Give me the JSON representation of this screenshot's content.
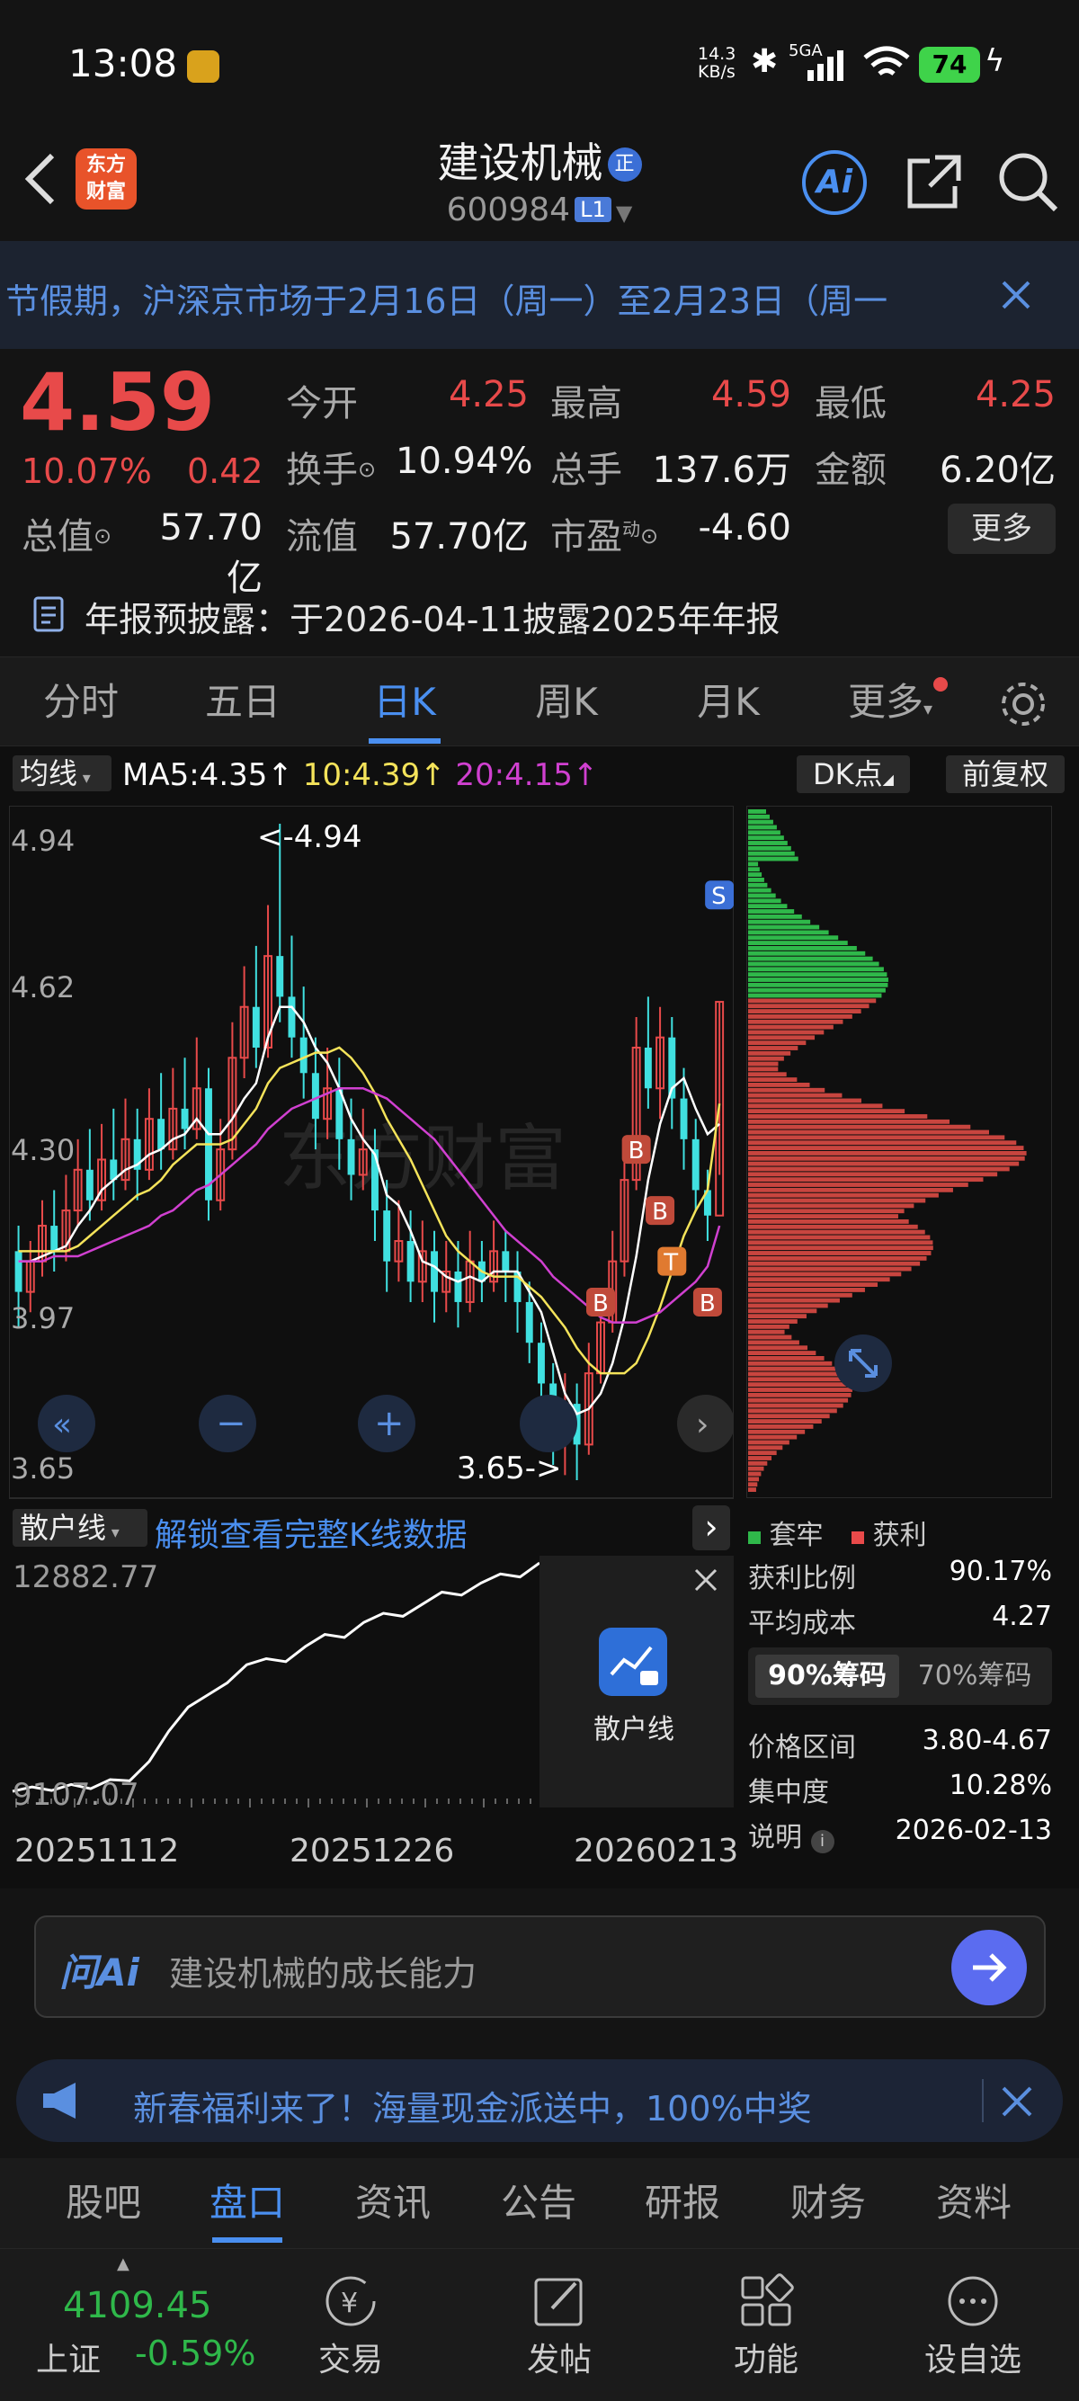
{
  "status": {
    "time": "13:08",
    "net_speed_value": "14.3",
    "net_speed_unit": "KB/s",
    "signal": "5GA",
    "battery": "74"
  },
  "nav": {
    "title": "建设机械",
    "title_badge": "正",
    "code": "600984",
    "level": "L1",
    "logo_line1": "东方",
    "logo_line2": "财富",
    "ai_label": "Ai"
  },
  "notice": {
    "text": "节假期，沪深京市场于2月16日（周一）至2月23日（周一"
  },
  "quote": {
    "price": "4.59",
    "change_pct": "10.07%",
    "change": "0.42",
    "open_label": "今开",
    "open": "4.25",
    "high_label": "最高",
    "high": "4.59",
    "low_label": "最低",
    "low": "4.25",
    "turnover_label": "换手",
    "turnover": "10.94%",
    "volume_label": "总手",
    "volume": "137.6万",
    "amount_label": "金额",
    "amount": "6.20亿",
    "mktcap_label": "总值",
    "mktcap": "57.70亿",
    "float_label": "流值",
    "float": "57.70亿",
    "pe_label": "市盈",
    "pe_sup": "动",
    "pe": "-4.60",
    "more_button": "更多",
    "report_text": "年报预披露：于2026-04-11披露2025年年报"
  },
  "tabs": [
    "分时",
    "五日",
    "日K",
    "周K",
    "月K",
    "更多"
  ],
  "active_tab": "日K",
  "kline": {
    "indicator": "均线",
    "ma5": "MA5:4.35↑",
    "ma10": "10:4.39↑",
    "ma20": "20:4.15↑",
    "dk_button": "DK点",
    "fq_button": "前复权",
    "y_ticks": [
      "4.94",
      "4.62",
      "4.30",
      "3.97",
      "3.65"
    ],
    "high_marker": "<-4.94",
    "low_marker": "3.65->",
    "watermark": "东方财富",
    "colors": {
      "up": "#e84a4a",
      "down": "#40e0e0",
      "ma5": "#ffffff",
      "ma10": "#f4e35a",
      "ma20": "#d040d0"
    }
  },
  "retail": {
    "dropdown": "散户线",
    "unlock_text": "解锁查看完整K线数据",
    "y_top": "12882.77",
    "y_bottom": "9107.07",
    "x_labels": [
      "20251112",
      "20251226",
      "20260213"
    ],
    "lock_label": "散户线"
  },
  "chips": {
    "legend_trapped": "套牢",
    "legend_profit": "获利",
    "profit_ratio_label": "获利比例",
    "profit_ratio": "90.17%",
    "avg_cost_label": "平均成本",
    "avg_cost": "4.27",
    "tab_90": "90%筹码",
    "tab_70": "70%筹码",
    "range_label": "价格区间",
    "range": "3.80-4.67",
    "concentration_label": "集中度",
    "concentration": "10.28%",
    "note_label": "说明",
    "note_date": "2026-02-13"
  },
  "chart_data": {
    "type": "candlestick",
    "ylim": [
      3.65,
      4.94
    ],
    "y_ticks": [
      4.94,
      4.62,
      4.3,
      3.97,
      3.65
    ],
    "candles": [
      [
        4.1,
        4.02,
        4.15,
        3.95
      ],
      [
        4.02,
        4.08,
        4.12,
        3.98
      ],
      [
        4.08,
        4.15,
        4.2,
        4.05
      ],
      [
        4.15,
        4.1,
        4.22,
        4.06
      ],
      [
        4.1,
        4.18,
        4.25,
        4.08
      ],
      [
        4.18,
        4.26,
        4.32,
        4.15
      ],
      [
        4.26,
        4.2,
        4.34,
        4.16
      ],
      [
        4.2,
        4.28,
        4.35,
        4.18
      ],
      [
        4.28,
        4.24,
        4.38,
        4.2
      ],
      [
        4.24,
        4.32,
        4.4,
        4.22
      ],
      [
        4.32,
        4.26,
        4.38,
        4.2
      ],
      [
        4.26,
        4.36,
        4.42,
        4.24
      ],
      [
        4.36,
        4.3,
        4.45,
        4.26
      ],
      [
        4.3,
        4.38,
        4.46,
        4.28
      ],
      [
        4.38,
        4.34,
        4.48,
        4.3
      ],
      [
        4.34,
        4.42,
        4.52,
        4.32
      ],
      [
        4.42,
        4.2,
        4.46,
        4.16
      ],
      [
        4.2,
        4.3,
        4.36,
        4.18
      ],
      [
        4.3,
        4.48,
        4.55,
        4.28
      ],
      [
        4.48,
        4.58,
        4.66,
        4.44
      ],
      [
        4.58,
        4.5,
        4.7,
        4.46
      ],
      [
        4.5,
        4.68,
        4.78,
        4.48
      ],
      [
        4.68,
        4.6,
        4.94,
        4.55
      ],
      [
        4.6,
        4.52,
        4.72,
        4.48
      ],
      [
        4.52,
        4.45,
        4.62,
        4.4
      ],
      [
        4.45,
        4.36,
        4.52,
        4.3
      ],
      [
        4.36,
        4.42,
        4.5,
        4.32
      ],
      [
        4.42,
        4.32,
        4.48,
        4.26
      ],
      [
        4.32,
        4.25,
        4.4,
        4.2
      ],
      [
        4.25,
        4.3,
        4.38,
        4.22
      ],
      [
        4.3,
        4.18,
        4.34,
        4.12
      ],
      [
        4.18,
        4.08,
        4.24,
        4.02
      ],
      [
        4.08,
        4.12,
        4.2,
        4.04
      ],
      [
        4.12,
        4.04,
        4.18,
        4.0
      ],
      [
        4.04,
        4.1,
        4.16,
        4.0
      ],
      [
        4.1,
        4.02,
        4.14,
        3.96
      ],
      [
        4.02,
        4.06,
        4.12,
        3.98
      ],
      [
        4.06,
        4.0,
        4.12,
        3.95
      ],
      [
        4.0,
        4.08,
        4.14,
        3.98
      ],
      [
        4.08,
        4.04,
        4.12,
        4.0
      ],
      [
        4.04,
        4.1,
        4.16,
        4.02
      ],
      [
        4.1,
        4.06,
        4.14,
        4.0
      ],
      [
        4.06,
        4.0,
        4.1,
        3.94
      ],
      [
        4.0,
        3.92,
        4.04,
        3.88
      ],
      [
        3.92,
        3.84,
        3.96,
        3.78
      ],
      [
        3.84,
        3.74,
        3.88,
        3.68
      ],
      [
        3.74,
        3.8,
        3.86,
        3.66
      ],
      [
        3.8,
        3.72,
        3.84,
        3.65
      ],
      [
        3.72,
        3.86,
        3.92,
        3.7
      ],
      [
        3.86,
        3.96,
        4.02,
        3.84
      ],
      [
        3.96,
        4.08,
        4.14,
        3.94
      ],
      [
        4.08,
        4.24,
        4.3,
        4.05
      ],
      [
        4.24,
        4.5,
        4.56,
        4.22
      ],
      [
        4.5,
        4.42,
        4.6,
        4.38
      ],
      [
        4.42,
        4.52,
        4.58,
        4.36
      ],
      [
        4.52,
        4.4,
        4.56,
        4.34
      ],
      [
        4.4,
        4.32,
        4.46,
        4.26
      ],
      [
        4.32,
        4.22,
        4.36,
        4.18
      ],
      [
        4.22,
        4.17,
        4.26,
        4.12
      ],
      [
        4.17,
        4.59,
        4.59,
        4.25
      ]
    ],
    "ma5": [
      4.08,
      4.08,
      4.09,
      4.1,
      4.11,
      4.15,
      4.18,
      4.22,
      4.24,
      4.26,
      4.27,
      4.29,
      4.3,
      4.32,
      4.33,
      4.36,
      4.33,
      4.33,
      4.36,
      4.4,
      4.43,
      4.52,
      4.58,
      4.58,
      4.55,
      4.5,
      4.47,
      4.42,
      4.36,
      4.32,
      4.29,
      4.21,
      4.19,
      4.14,
      4.08,
      4.07,
      4.05,
      4.04,
      4.05,
      4.04,
      4.06,
      4.06,
      4.06,
      4.02,
      3.98,
      3.9,
      3.82,
      3.78,
      3.79,
      3.82,
      3.88,
      3.97,
      4.09,
      4.24,
      4.35,
      4.42,
      4.44,
      4.38,
      4.33,
      4.35
    ],
    "ma10": [
      4.1,
      4.1,
      4.1,
      4.1,
      4.1,
      4.11,
      4.13,
      4.15,
      4.17,
      4.19,
      4.21,
      4.22,
      4.24,
      4.27,
      4.29,
      4.31,
      4.31,
      4.31,
      4.32,
      4.35,
      4.38,
      4.43,
      4.46,
      4.47,
      4.48,
      4.49,
      4.49,
      4.5,
      4.48,
      4.45,
      4.41,
      4.36,
      4.32,
      4.28,
      4.23,
      4.18,
      4.13,
      4.1,
      4.08,
      4.06,
      4.05,
      4.05,
      4.05,
      4.03,
      4.01,
      3.98,
      3.95,
      3.91,
      3.88,
      3.86,
      3.86,
      3.86,
      3.88,
      3.93,
      3.99,
      4.06,
      4.13,
      4.18,
      4.22,
      4.39
    ],
    "ma20": [
      4.08,
      4.08,
      4.08,
      4.09,
      4.09,
      4.09,
      4.1,
      4.11,
      4.12,
      4.13,
      4.14,
      4.15,
      4.17,
      4.18,
      4.2,
      4.22,
      4.23,
      4.25,
      4.27,
      4.29,
      4.31,
      4.34,
      4.36,
      4.38,
      4.39,
      4.4,
      4.41,
      4.42,
      4.42,
      4.42,
      4.41,
      4.4,
      4.38,
      4.36,
      4.34,
      4.32,
      4.29,
      4.26,
      4.23,
      4.2,
      4.17,
      4.14,
      4.12,
      4.1,
      4.08,
      4.05,
      4.03,
      4.01,
      3.99,
      3.97,
      3.96,
      3.96,
      3.96,
      3.97,
      3.98,
      4.0,
      4.02,
      4.04,
      4.07,
      4.15
    ],
    "signals": [
      {
        "label": "B",
        "index": 52,
        "price": 4.3
      },
      {
        "label": "B",
        "index": 54,
        "price": 4.18
      },
      {
        "label": "B",
        "index": 49,
        "price": 4.0
      },
      {
        "label": "T",
        "index": 55,
        "price": 4.08
      },
      {
        "label": "B",
        "index": 58,
        "price": 4.0
      },
      {
        "label": "S",
        "index": 59,
        "price": 4.8
      }
    ],
    "chip_distribution": {
      "price_range": [
        3.65,
        4.94
      ],
      "avg_cost": 4.27,
      "profit_ratio": 0.9017
    },
    "retail_line": {
      "ylim": [
        9107.07,
        12882.77
      ],
      "x": [
        "20251112",
        "20251226",
        "20260213"
      ]
    }
  },
  "askai": {
    "logo": "问Ai",
    "placeholder": "建设机械的成长能力"
  },
  "promo": {
    "text": "新春福利来了！海量现金派送中，100%中奖"
  },
  "bottom_tabs": [
    "股吧",
    "盘口",
    "资讯",
    "公告",
    "研报",
    "财务",
    "资料"
  ],
  "bottom_active": "盘口",
  "index": {
    "value": "4109.45",
    "name": "上证",
    "change": "-0.59%"
  },
  "actions": [
    "交易",
    "发帖",
    "功能",
    "设自选"
  ]
}
